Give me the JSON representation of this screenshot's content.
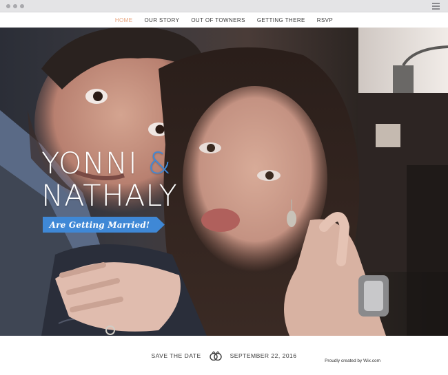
{
  "nav": {
    "items": [
      {
        "label": "HOME",
        "active": true
      },
      {
        "label": "OUR STORY",
        "active": false
      },
      {
        "label": "OUT OF TOWNERS",
        "active": false
      },
      {
        "label": "GETTING THERE",
        "active": false
      },
      {
        "label": "RSVP",
        "active": false
      }
    ]
  },
  "hero": {
    "name1": "YONNI",
    "amp": "&",
    "name2": "NATHALY",
    "ribbon": "Are Getting Married!"
  },
  "footer": {
    "save_label": "SAVE THE DATE",
    "date": "SEPTEMBER 22, 2016",
    "rings_icon": "wedding-rings-icon",
    "credit": "Proudly created by Wix.com"
  },
  "colors": {
    "accent_blue": "#3f88d6",
    "nav_active": "#e8a27a",
    "text_dark": "#3a3a3a"
  },
  "chrome": {
    "menu_icon": "hamburger-menu-icon"
  }
}
